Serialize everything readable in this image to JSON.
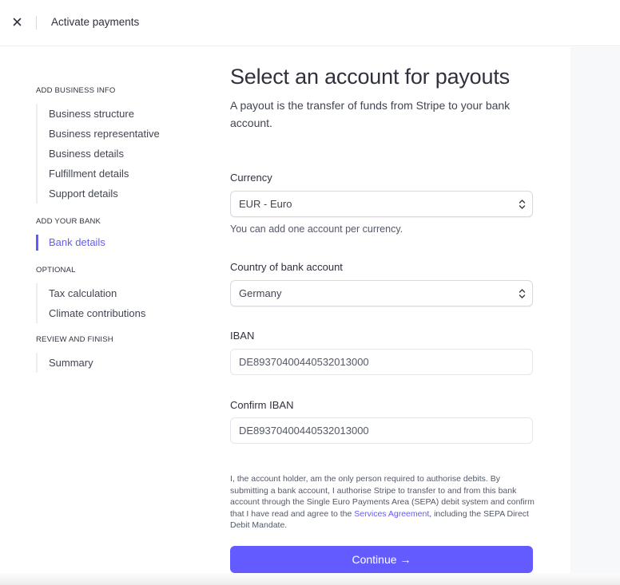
{
  "header": {
    "title": "Activate payments",
    "close_icon": "close-icon"
  },
  "sidebar": {
    "sections": [
      {
        "title": "ADD BUSINESS INFO",
        "items": [
          {
            "label": "Business structure",
            "active": false
          },
          {
            "label": "Business representative",
            "active": false
          },
          {
            "label": "Business details",
            "active": false
          },
          {
            "label": "Fulfillment details",
            "active": false
          },
          {
            "label": "Support details",
            "active": false
          }
        ]
      },
      {
        "title": "ADD YOUR BANK",
        "items": [
          {
            "label": "Bank details",
            "active": true
          }
        ]
      },
      {
        "title": "OPTIONAL",
        "items": [
          {
            "label": "Tax calculation",
            "active": false
          },
          {
            "label": "Climate contributions",
            "active": false
          }
        ]
      },
      {
        "title": "REVIEW AND FINISH",
        "items": [
          {
            "label": "Summary",
            "active": false
          }
        ]
      }
    ]
  },
  "main": {
    "title": "Select an account for payouts",
    "subtitle": "A payout is the transfer of funds from Stripe to your bank account.",
    "currency": {
      "label": "Currency",
      "value": "EUR - Euro",
      "help": "You can add one account per currency."
    },
    "country": {
      "label": "Country of bank account",
      "value": "Germany"
    },
    "iban": {
      "label": "IBAN",
      "value": "DE89370400440532013000"
    },
    "confirm_iban": {
      "label": "Confirm IBAN",
      "value": "DE89370400440532013000"
    },
    "legal": {
      "text_before": "I, the account holder, am the only person required to authorise debits. By submitting a bank account, I authorise Stripe to transfer to and from this bank account through the Single Euro Payments Area (SEPA) debit system and confirm that I have read and agree to the ",
      "link": "Services Agreement",
      "text_after": ", including the SEPA Direct Debit Mandate."
    },
    "continue_label": "Continue",
    "continue_arrow": "→"
  },
  "colors": {
    "accent": "#635bff",
    "text": "#30313d",
    "border": "#d5dbe1",
    "panel": "#f6f8fa"
  }
}
